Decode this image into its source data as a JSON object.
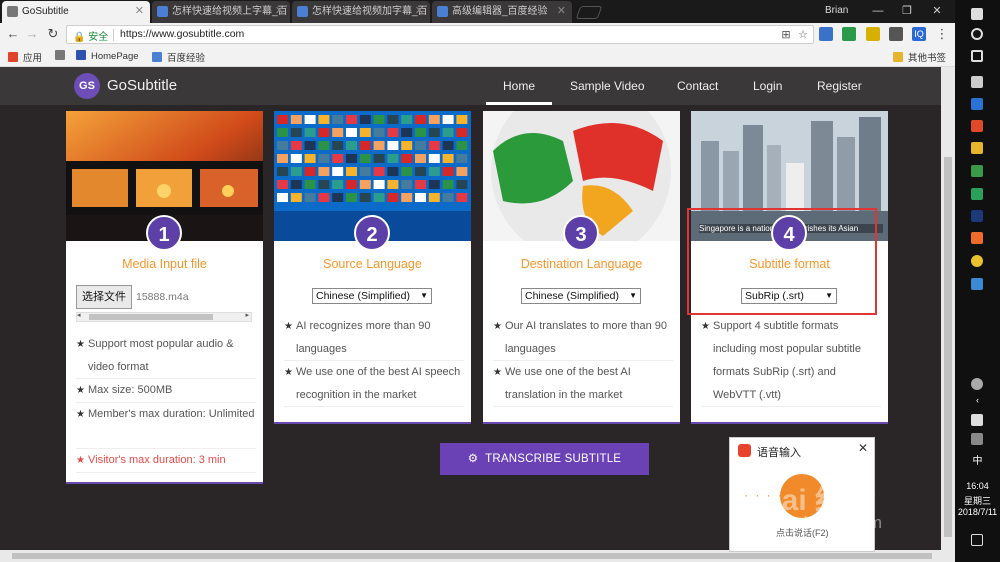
{
  "browser": {
    "tabs": [
      {
        "title": "GoSubtitle",
        "active": true
      },
      {
        "title": "怎样快速给视频上字幕_百"
      },
      {
        "title": "怎样快速给视频加字幕_百"
      },
      {
        "title": "高级编辑器_百度经验"
      }
    ],
    "user": "Brian",
    "secure_label": "安全",
    "url": "https://www.gosubtitle.com",
    "bookmarks": [
      "应用",
      "HomePage",
      "百度经验"
    ],
    "other_bookmarks": "其他书签"
  },
  "site": {
    "logo": "GS",
    "brand": "GoSubtitle",
    "nav": [
      "Home",
      "Sample Video",
      "Contact",
      "Login",
      "Register"
    ]
  },
  "cards": [
    {
      "num": "1",
      "title": "Media Input file",
      "file_button": "选择文件",
      "file_name": "15888.m4a",
      "features": [
        "Support most popular audio & video format",
        "Max size: 500MB",
        "Member's max duration: Unlimited",
        "Visitor's max duration: 3 min"
      ]
    },
    {
      "num": "2",
      "title": "Source Language",
      "select": "Chinese (Simplified)",
      "features": [
        "AI recognizes more than 90 languages",
        "We use one of the best AI speech recognition in the market"
      ]
    },
    {
      "num": "3",
      "title": "Destination Language",
      "select": "Chinese (Simplified)",
      "features": [
        "Our AI translates to more than 90 languages",
        "We use one of the best AI translation in the market"
      ]
    },
    {
      "num": "4",
      "title": "Subtitle format",
      "select": "SubRip (.srt)",
      "caption": "Singapore is a nation that cherishes its Asian",
      "features": [
        "Support 4 subtitle formats including most popular subtitle formats SubRip (.srt) and WebVTT (.vtt)"
      ]
    }
  ],
  "transcribe_label": "TRANSCRIBE SUBTITLE",
  "voice_popup": {
    "title": "语音输入",
    "hint": "点击说话(F2)"
  },
  "watermark": "Bai 经验",
  "watermark_url": "jingyan.baidu.com",
  "taskbar": {
    "ime": "中",
    "time": "16:04",
    "weekday": "星期三",
    "date": "2018/7/11"
  },
  "colors": {
    "accent": "#6a42b5",
    "orange": "#f4962a",
    "highlight": "#e03535"
  }
}
